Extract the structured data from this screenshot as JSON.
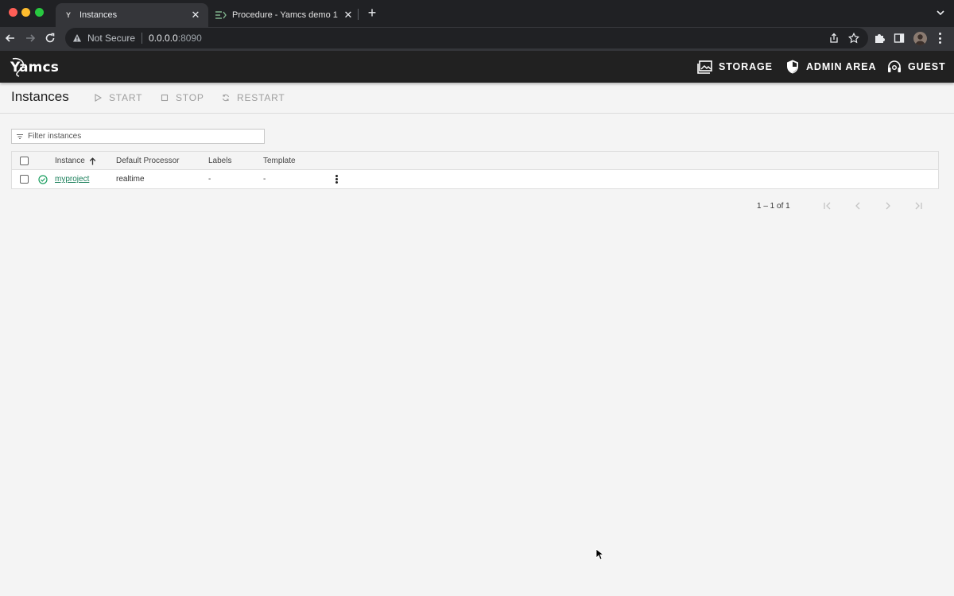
{
  "browser": {
    "tabs": [
      {
        "title": "Instances",
        "active": true,
        "favicon": "yamcs-favicon"
      },
      {
        "title": "Procedure - Yamcs demo 1",
        "active": false,
        "favicon": "procedure-favicon"
      }
    ],
    "address": {
      "security_label": "Not Secure",
      "host": "0.0.0.0",
      "port": ":8090"
    }
  },
  "app": {
    "logo_text": "Yamcs",
    "header_actions": [
      {
        "label": "STORAGE",
        "icon": "storage-icon"
      },
      {
        "label": "ADMIN AREA",
        "icon": "shield-icon"
      },
      {
        "label": "GUEST",
        "icon": "account-icon"
      }
    ]
  },
  "page": {
    "title": "Instances",
    "actions": [
      {
        "label": "START",
        "icon": "play-icon"
      },
      {
        "label": "STOP",
        "icon": "stop-icon"
      },
      {
        "label": "RESTART",
        "icon": "restart-icon"
      }
    ]
  },
  "filter": {
    "placeholder": "Filter instances",
    "value": ""
  },
  "table": {
    "columns": [
      "Instance",
      "Default Processor",
      "Labels",
      "Template"
    ],
    "sort_column": "Instance",
    "sort_direction": "ascending",
    "rows": [
      {
        "instance": "myproject",
        "status": "running",
        "processor": "realtime",
        "labels": "-",
        "template": "-"
      }
    ]
  },
  "paginator": {
    "range_label": "1 – 1 of 1"
  },
  "colors": {
    "app_header": "#212121",
    "link": "#1a7f5a",
    "status_ok": "#1a9e5f",
    "background": "#f4f4f4"
  }
}
